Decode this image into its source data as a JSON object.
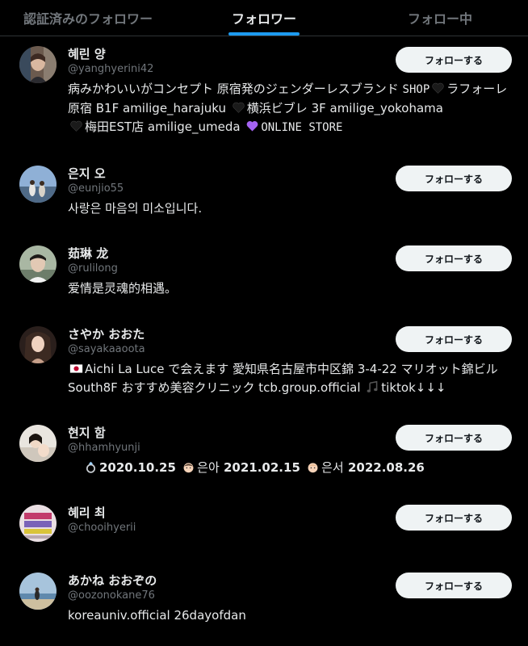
{
  "tabs": [
    {
      "label": "認証済みのフォロワー",
      "active": false
    },
    {
      "label": "フォロワー",
      "active": true
    },
    {
      "label": "フォロー中",
      "active": false
    }
  ],
  "follow_button_label": "フォローする",
  "users": [
    {
      "name": "혜린 양",
      "handle": "@yanghyerini42",
      "bio": {
        "p1": "病みかわいいがコンセプト 原宿発のジェンダーレスブランド ",
        "p2": "SHOP",
        "p3": "ラフォーレ原宿 B1F amilige_harajuku ",
        "p4": "横浜ビブレ 3F amilige_yokohama",
        "p5": "梅田EST店 amilige_umeda ",
        "p6": "ONLINE STORE"
      },
      "icons": [
        "black-heart-icon",
        "black-heart-icon",
        "black-heart-icon",
        "purple-heart-icon"
      ],
      "colors": {
        "black_heart": "#1a1a1a",
        "purple_heart": "#a463f2"
      }
    },
    {
      "name": "은지 오",
      "handle": "@eunjio55",
      "bio": {
        "text": "사랑은 마음의 미소입니다."
      }
    },
    {
      "name": "茹琳 龙",
      "handle": "@rulilong",
      "bio": {
        "text": "爱情是灵魂的相遇。"
      }
    },
    {
      "name": "さやか おおた",
      "handle": "@sayakaaoota",
      "bio": {
        "p1": "Aichi La Luce で会えます 愛知県名古屋市中区錦 3-4-22 マリオット錦ビル South8F おすすめ美容クリニック tcb.group.official ",
        "p2": "tiktok↓↓↓"
      },
      "icons": [
        "japan-flag-icon",
        "musical-notes-icon"
      ]
    },
    {
      "name": "현지 함",
      "handle": "@hhamhyunji",
      "bio": {
        "d1": "2020.10.25",
        "t1": "은아",
        "d2": "2021.02.15",
        "t2": "은서",
        "d3": "2022.08.26"
      },
      "icons": [
        "ring-icon",
        "baby-icon",
        "baby-icon"
      ]
    },
    {
      "name": "혜리 최",
      "handle": "@chooihyerii",
      "bio": {
        "text": ""
      }
    },
    {
      "name": "あかね おおぞの",
      "handle": "@oozonokane76",
      "bio": {
        "text": "koreauniv.official 26dayofdan"
      }
    }
  ]
}
